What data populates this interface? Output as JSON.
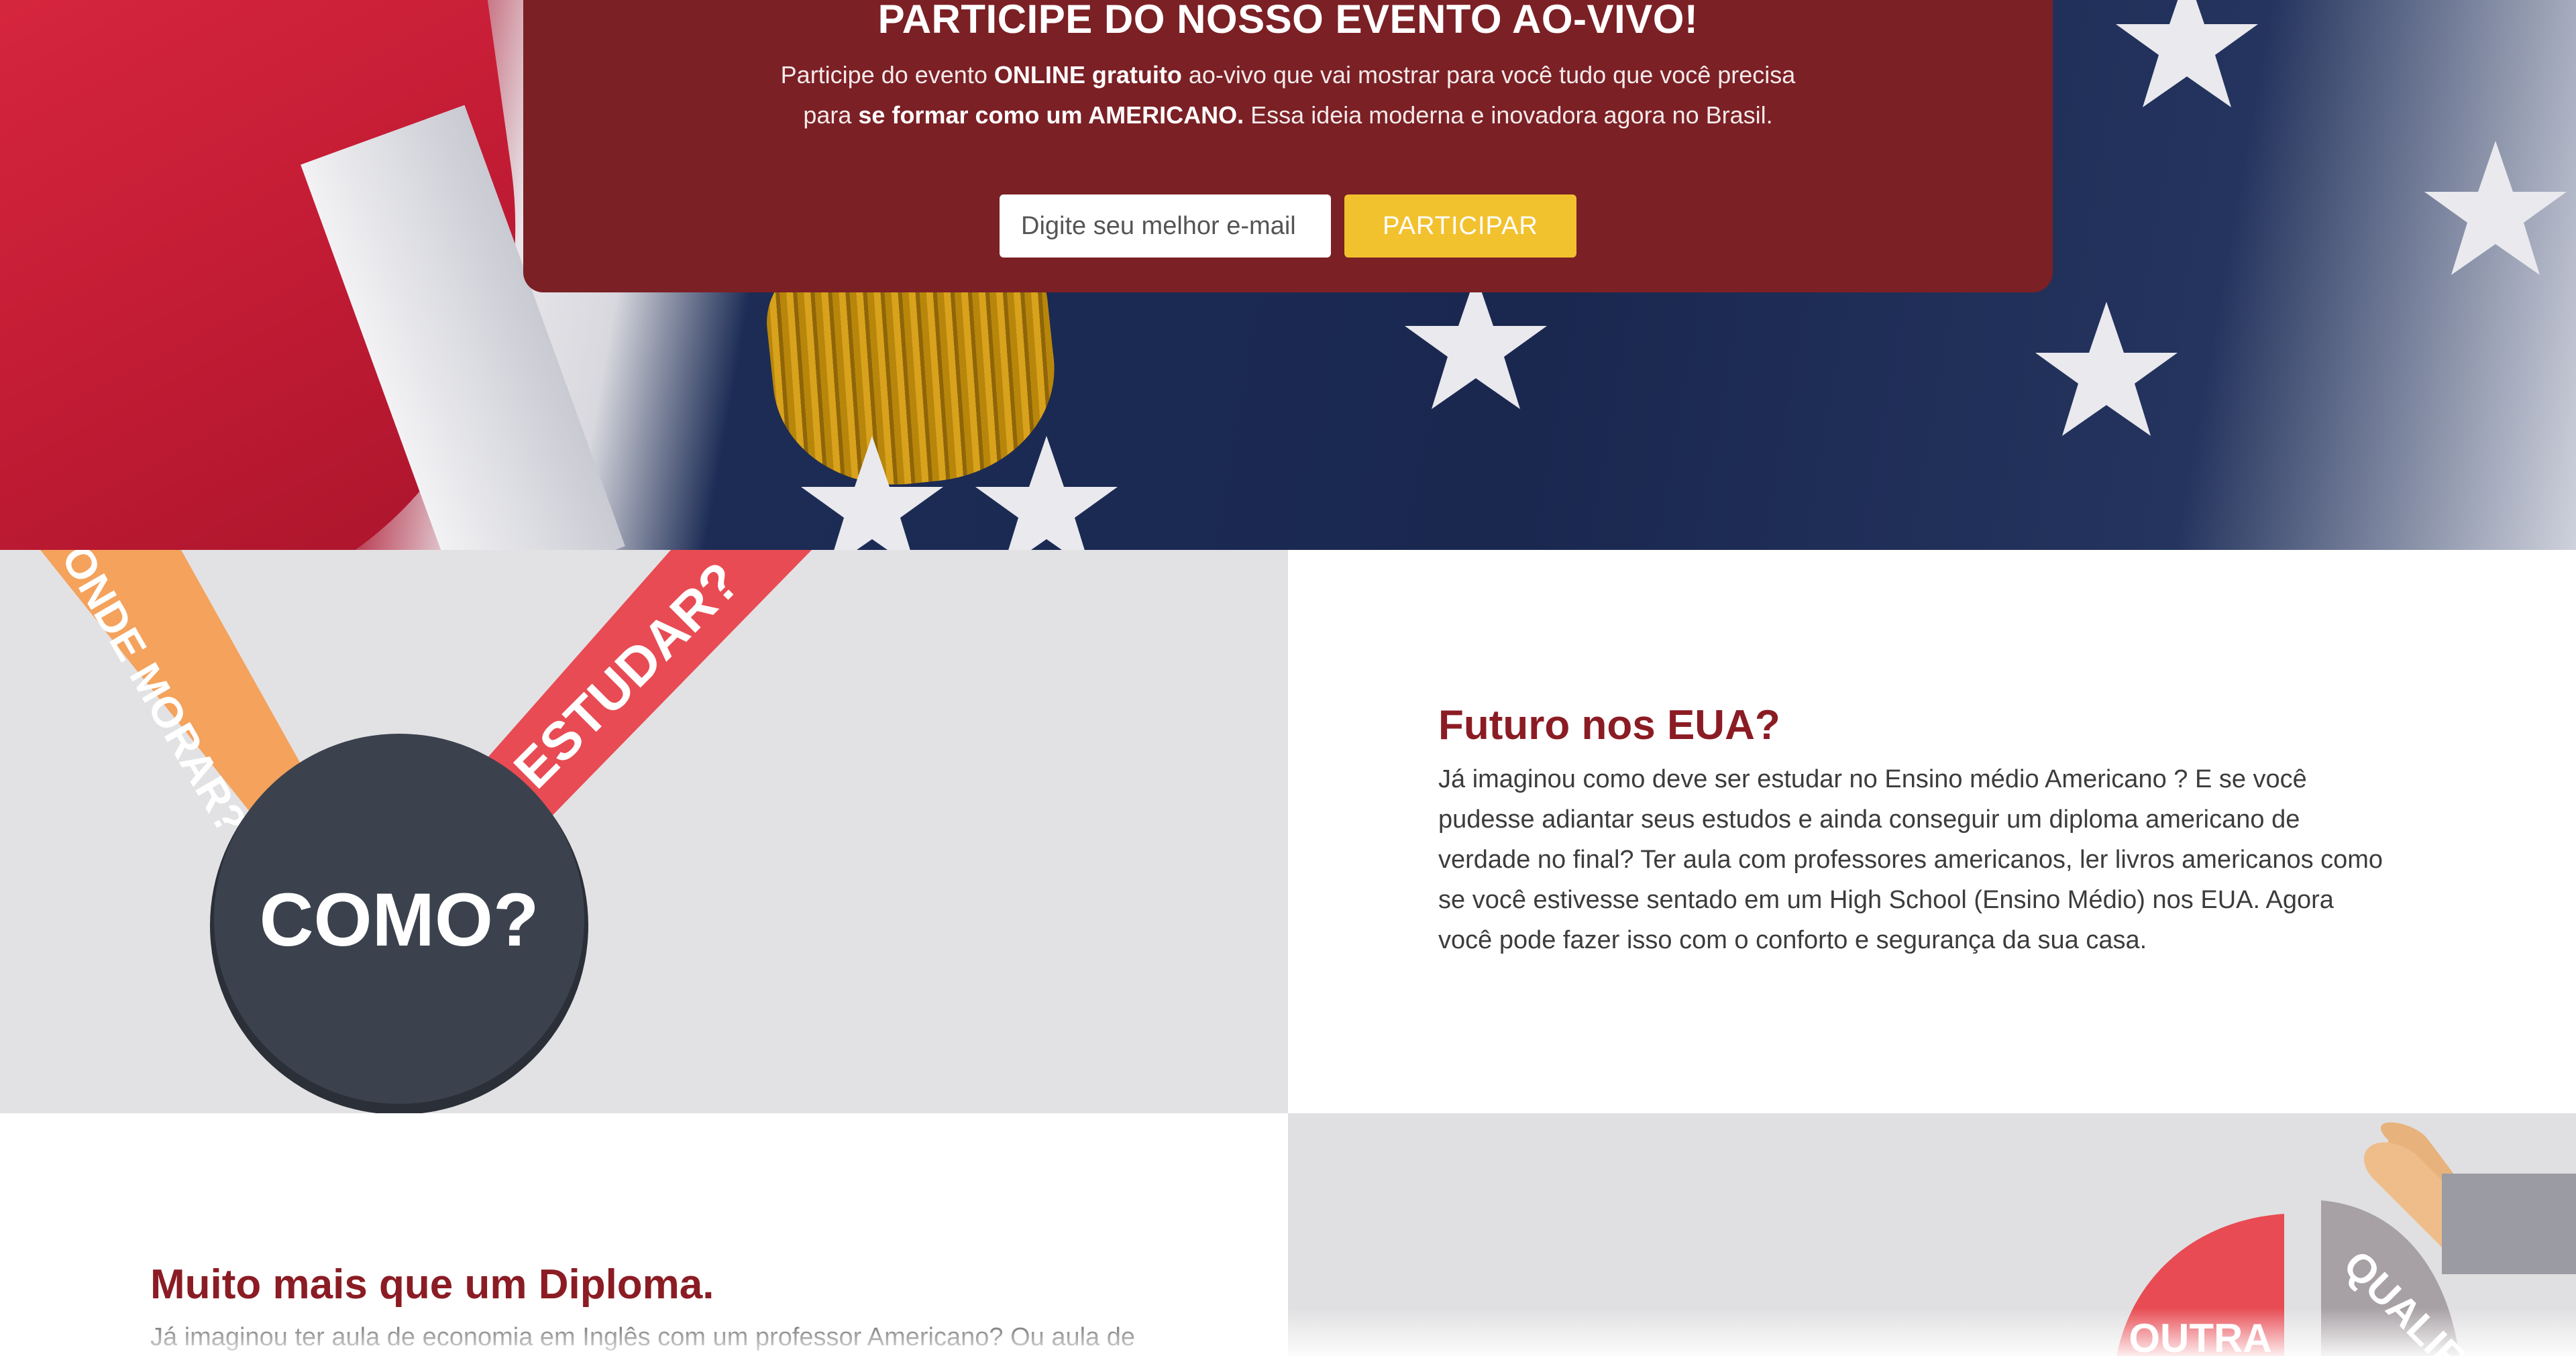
{
  "banner": {
    "title": "PARTICIPE DO NOSSO EVENTO AO-VIVO!",
    "text_1": "Participe do evento ",
    "text_2": "ONLINE gratuito",
    "text_3": " ao-vivo que vai mostrar para você tudo que você precisa para ",
    "text_4": "se formar como um AMERICANO.",
    "text_5": " Essa ideia moderna e inovadora agora no Brasil.",
    "email_placeholder": "Digite seu melhor e-mail",
    "button_label": "PARTICIPAR"
  },
  "futuro": {
    "title": "Futuro nos EUA?",
    "body": "Já imaginou como deve ser estudar no Ensino médio Americano ? E se você pudesse adiantar seus estudos e ainda conseguir um diploma americano de verdade no final? Ter aula com professores americanos, ler livros americanos como se você estivesse sentado em um High School (Ensino Médio) nos EUA. Agora você pode fazer isso com o conforto e segurança da sua casa.",
    "image": {
      "ribbon_left": "ONDE MORAR?",
      "ribbon_right": "ESTUDAR?",
      "circle": "COMO?"
    }
  },
  "diploma": {
    "title": "Muito mais que um Diploma.",
    "body": "Já imaginou ter aula de economia em Inglês com um professor Americano? Ou aula de",
    "image": {
      "label_left": "OUTRA",
      "label_right": "QUALIFI"
    }
  },
  "colors": {
    "banner_bg": "#7b2025",
    "button_bg": "#f2c12e",
    "title_color": "#8b1c24"
  }
}
